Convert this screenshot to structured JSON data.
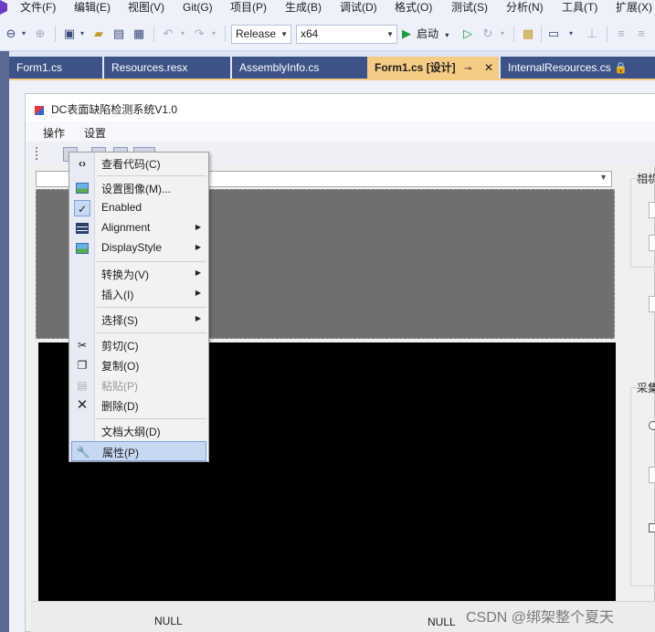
{
  "menubar": {
    "items": [
      "文件(F)",
      "编辑(E)",
      "视图(V)",
      "Git(G)",
      "项目(P)",
      "生成(B)",
      "调试(D)",
      "格式(O)",
      "测试(S)",
      "分析(N)",
      "工具(T)",
      "扩展(X)"
    ]
  },
  "toolbar": {
    "configuration": "Release",
    "platform": "x64",
    "start_label": "启动",
    "icons": [
      "back-icon",
      "forward-icon",
      "new-project-icon",
      "open-icon",
      "save-icon",
      "save-all-icon",
      "undo-icon",
      "redo-icon",
      "start-icon",
      "start-without-debug-icon",
      "hot-reload-icon",
      "solution-explorer-icon",
      "window-layout-icon"
    ]
  },
  "tabs": [
    {
      "label": "Form1.cs",
      "active": false
    },
    {
      "label": "Resources.resx",
      "active": false
    },
    {
      "label": "AssemblyInfo.cs",
      "active": false
    },
    {
      "label": "Form1.cs [设计]",
      "active": true,
      "pin": "⊸",
      "close": "✕"
    },
    {
      "label": "InternalResources.cs 🔒",
      "active": false
    }
  ],
  "form": {
    "title": "DC表面缺陷检测系统V1.0",
    "menu": [
      "操作",
      "设置"
    ],
    "right_labels": {
      "camera": "相机",
      "capture": "采集"
    },
    "status": {
      "left": "NULL",
      "right": "NULL"
    }
  },
  "context_menu": {
    "items": [
      {
        "icon": "code-icon",
        "label": "查看代码(C)",
        "submenu": false,
        "disabled": false,
        "highlighted": false
      },
      {
        "icon": "image-icon",
        "label": "设置图像(M)...",
        "submenu": false,
        "disabled": false,
        "highlighted": false
      },
      {
        "icon": "check-icon",
        "label": "Enabled",
        "submenu": false,
        "disabled": false,
        "highlighted": false
      },
      {
        "icon": "alignment-icon",
        "label": "Alignment",
        "submenu": true,
        "disabled": false,
        "highlighted": false
      },
      {
        "icon": "display-style-icon",
        "label": "DisplayStyle",
        "submenu": true,
        "disabled": false,
        "highlighted": false
      },
      {
        "icon": "",
        "label": "转换为(V)",
        "submenu": true,
        "disabled": false,
        "highlighted": false
      },
      {
        "icon": "",
        "label": "插入(I)",
        "submenu": true,
        "disabled": false,
        "highlighted": false
      },
      {
        "icon": "",
        "label": "选择(S)",
        "submenu": true,
        "disabled": false,
        "highlighted": false
      },
      {
        "icon": "cut-icon",
        "label": "剪切(C)",
        "submenu": false,
        "disabled": false,
        "highlighted": false
      },
      {
        "icon": "copy-icon",
        "label": "复制(O)",
        "submenu": false,
        "disabled": false,
        "highlighted": false
      },
      {
        "icon": "paste-icon",
        "label": "粘贴(P)",
        "submenu": false,
        "disabled": true,
        "highlighted": false
      },
      {
        "icon": "delete-icon",
        "label": "删除(D)",
        "submenu": false,
        "disabled": false,
        "highlighted": false
      },
      {
        "icon": "",
        "label": "文档大纲(D)",
        "submenu": false,
        "disabled": false,
        "highlighted": false
      },
      {
        "icon": "wrench-icon",
        "label": "属性(P)",
        "submenu": false,
        "disabled": false,
        "highlighted": true
      }
    ]
  },
  "watermark": "CSDN @绑架整个夏天"
}
